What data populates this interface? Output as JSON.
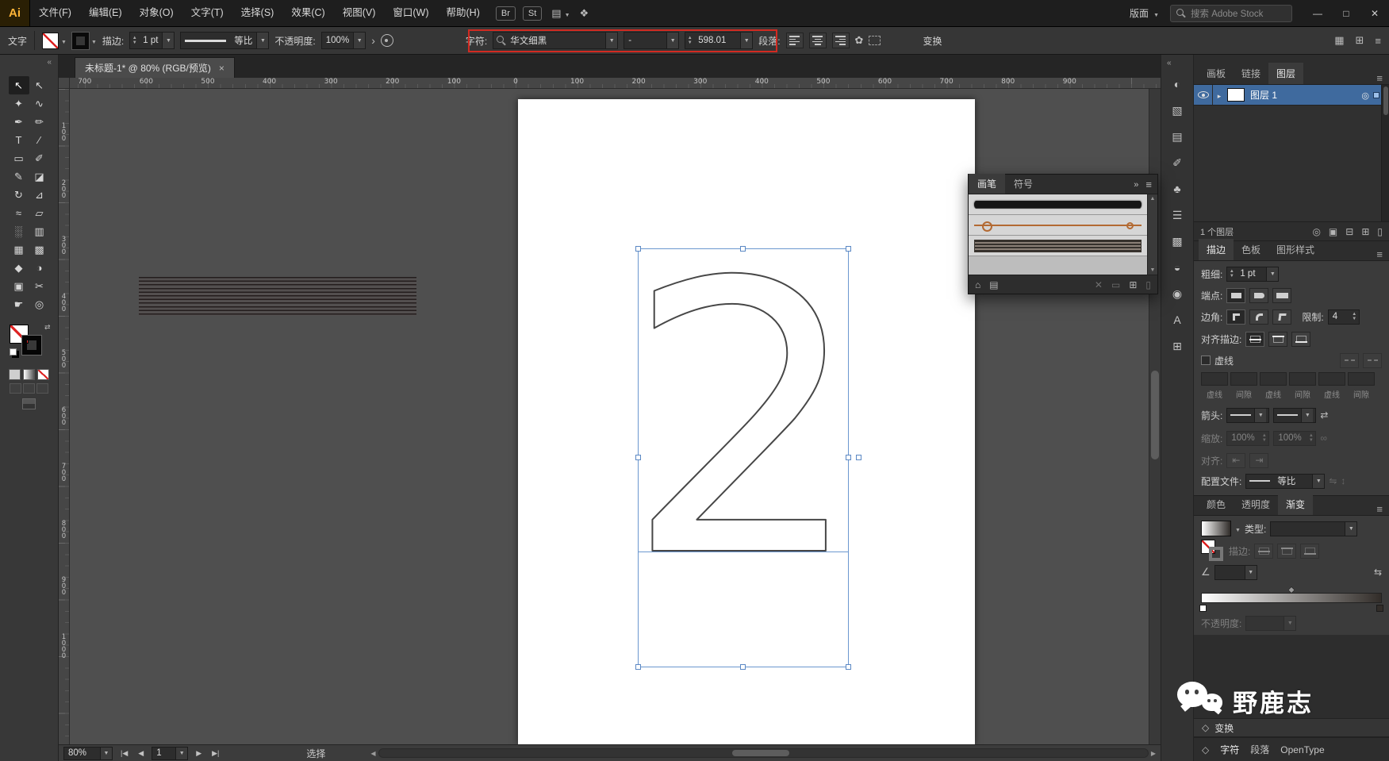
{
  "colors": {
    "selection_accent": "#6b97cf",
    "highlight_red": "#d22a21",
    "layer_selected_blue": "#3f6a9e",
    "brush_orange": "#b36a33",
    "panel_bg": "#3b3b3b",
    "chrome_bg": "#1e1e1e"
  },
  "titlebar": {
    "logo": "Ai",
    "menus": [
      "文件(F)",
      "编辑(E)",
      "对象(O)",
      "文字(T)",
      "选择(S)",
      "效果(C)",
      "视图(V)",
      "窗口(W)",
      "帮助(H)"
    ],
    "bridge_label": "Br",
    "stock_label": "St",
    "arrange_icon": "▤",
    "workspace_icon": "❖",
    "layout_label": "版面",
    "search_placeholder": "搜索 Adobe Stock",
    "minimize_icon": "—",
    "maximize_icon": "□",
    "close_icon": "✕"
  },
  "controlbar": {
    "context_label": "文字",
    "stroke_label": "描边:",
    "stroke_value": "1 pt",
    "variable_width_profile": "等比",
    "opacity_label": "不透明度:",
    "opacity_value": "100%",
    "char_label": "字符:",
    "font_name": "华文细黑",
    "font_style": "-",
    "font_size": "598.01",
    "paragraph_label": "段落:",
    "transform_label": "变换"
  },
  "document_tab": {
    "title": "未标题-1* @ 80% (RGB/预览)",
    "close_icon": "×"
  },
  "toolbar": {
    "collapse_icon": "«",
    "tools": [
      {
        "name": "selection-tool",
        "glyph": "↖",
        "active": true
      },
      {
        "name": "direct-selection-tool",
        "glyph": "↖"
      },
      {
        "name": "magic-wand-tool",
        "glyph": "✦"
      },
      {
        "name": "lasso-tool",
        "glyph": "∿"
      },
      {
        "name": "pen-tool",
        "glyph": "✒"
      },
      {
        "name": "curvature-tool",
        "glyph": "✏"
      },
      {
        "name": "type-tool",
        "glyph": "T"
      },
      {
        "name": "line-segment-tool",
        "glyph": "∕"
      },
      {
        "name": "rectangle-tool",
        "glyph": "▭"
      },
      {
        "name": "paintbrush-tool",
        "glyph": "✐"
      },
      {
        "name": "shaper-tool",
        "glyph": "✎"
      },
      {
        "name": "eraser-tool",
        "glyph": "◪"
      },
      {
        "name": "rotate-tool",
        "glyph": "↻"
      },
      {
        "name": "scale-tool",
        "glyph": "⊿"
      },
      {
        "name": "width-tool",
        "glyph": "≈"
      },
      {
        "name": "free-transform-tool",
        "glyph": "▱"
      },
      {
        "name": "symbol-sprayer-tool",
        "glyph": "░"
      },
      {
        "name": "column-graph-tool",
        "glyph": "▥"
      },
      {
        "name": "mesh-tool",
        "glyph": "▦"
      },
      {
        "name": "gradient-tool",
        "glyph": "▩"
      },
      {
        "name": "eyedropper-tool",
        "glyph": "◆"
      },
      {
        "name": "blend-tool",
        "glyph": "◑"
      },
      {
        "name": "artboard-tool",
        "glyph": "▣"
      },
      {
        "name": "slice-tool",
        "glyph": "✂"
      },
      {
        "name": "hand-tool",
        "glyph": "☛"
      },
      {
        "name": "zoom-tool",
        "glyph": "◎"
      }
    ]
  },
  "rulers": {
    "top": [
      "700",
      "600",
      "500",
      "400",
      "300",
      "200",
      "100",
      "0",
      "100",
      "200",
      "300",
      "400",
      "500",
      "600",
      "700",
      "800",
      "900"
    ],
    "left": [
      "100",
      "200",
      "300",
      "400",
      "500",
      "600",
      "700",
      "800",
      "900",
      "1000"
    ]
  },
  "canvas": {
    "text_object": "2"
  },
  "statusbar": {
    "zoom": "80%",
    "nav_first": "|◀",
    "nav_prev": "◀",
    "artboard_number": "1",
    "nav_next": "▶",
    "nav_last": "▶|",
    "status_text": "选择"
  },
  "icon_strip": [
    {
      "name": "color-icon",
      "glyph": "◐"
    },
    {
      "name": "color-guide-icon",
      "glyph": "▧"
    },
    {
      "name": "swatches-icon",
      "glyph": "▤"
    },
    {
      "name": "brushes-icon",
      "glyph": "✐"
    },
    {
      "name": "symbols-icon",
      "glyph": "♣"
    },
    {
      "name": "stroke-icon",
      "glyph": "☰"
    },
    {
      "name": "gradient-icon",
      "glyph": "▩"
    },
    {
      "name": "transparency-icon",
      "glyph": "◒"
    },
    {
      "name": "appearance-icon",
      "glyph": "◉"
    },
    {
      "name": "character-icon",
      "glyph": "A"
    },
    {
      "name": "libraries-icon",
      "glyph": "⊞"
    }
  ],
  "dock": {
    "tabs": [
      "画板",
      "链接",
      "图层"
    ],
    "layers": {
      "layer_name": "图层 1",
      "count_text": "1 个图层",
      "action_icons": [
        {
          "name": "locate-object-icon",
          "glyph": "◎"
        },
        {
          "name": "make-clip-mask-icon",
          "glyph": "▣"
        },
        {
          "name": "new-sublayer-icon",
          "glyph": "⊟"
        },
        {
          "name": "new-layer-icon",
          "glyph": "⊞"
        },
        {
          "name": "delete-layer-icon",
          "glyph": "▯"
        }
      ]
    },
    "stroke_panel": {
      "tabs": [
        "描边",
        "色板",
        "图形样式"
      ],
      "weight_label": "粗细:",
      "weight_value": "1 pt",
      "cap_label": "端点:",
      "corner_label": "边角:",
      "limit_label": "限制:",
      "limit_value": "4",
      "align_stroke_label": "对齐描边:",
      "dashed_label": "虚线",
      "dash_fields": [
        "虚线",
        "间隙",
        "虚线",
        "间隙",
        "虚线",
        "间隙"
      ],
      "arrowheads_label": "箭头:",
      "scale_label": "缩放:",
      "scale_value_1": "100%",
      "scale_value_2": "100%",
      "align_label": "对齐:",
      "profile_label": "配置文件:",
      "profile_value": "等比"
    },
    "gradient_panel": {
      "tabs": [
        "颜色",
        "透明度",
        "渐变"
      ],
      "type_label": "类型:",
      "stroke_label": "描边:",
      "opacity_label": "不透明度:"
    },
    "transform_label": "变换",
    "bottom_tabs": [
      "字符",
      "段落",
      "OpenType"
    ]
  },
  "brushes_panel": {
    "tabs": [
      "画笔",
      "符号"
    ],
    "expand_icon": "»",
    "brushes": [
      {
        "name": "charcoal-brush"
      },
      {
        "name": "artistic-ink-brush"
      },
      {
        "name": "banded-stripe-brush"
      }
    ]
  },
  "watermark": {
    "text": "野鹿志"
  }
}
